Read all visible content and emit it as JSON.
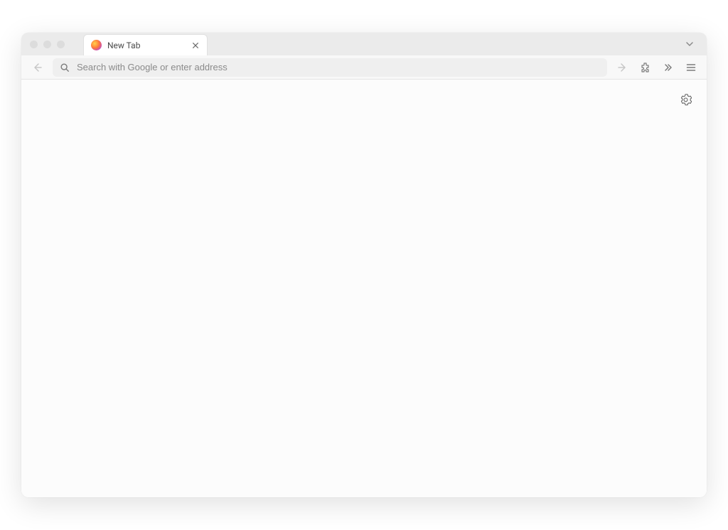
{
  "tabs": [
    {
      "title": "New Tab"
    }
  ],
  "urlbar": {
    "placeholder": "Search with Google or enter address",
    "value": ""
  }
}
